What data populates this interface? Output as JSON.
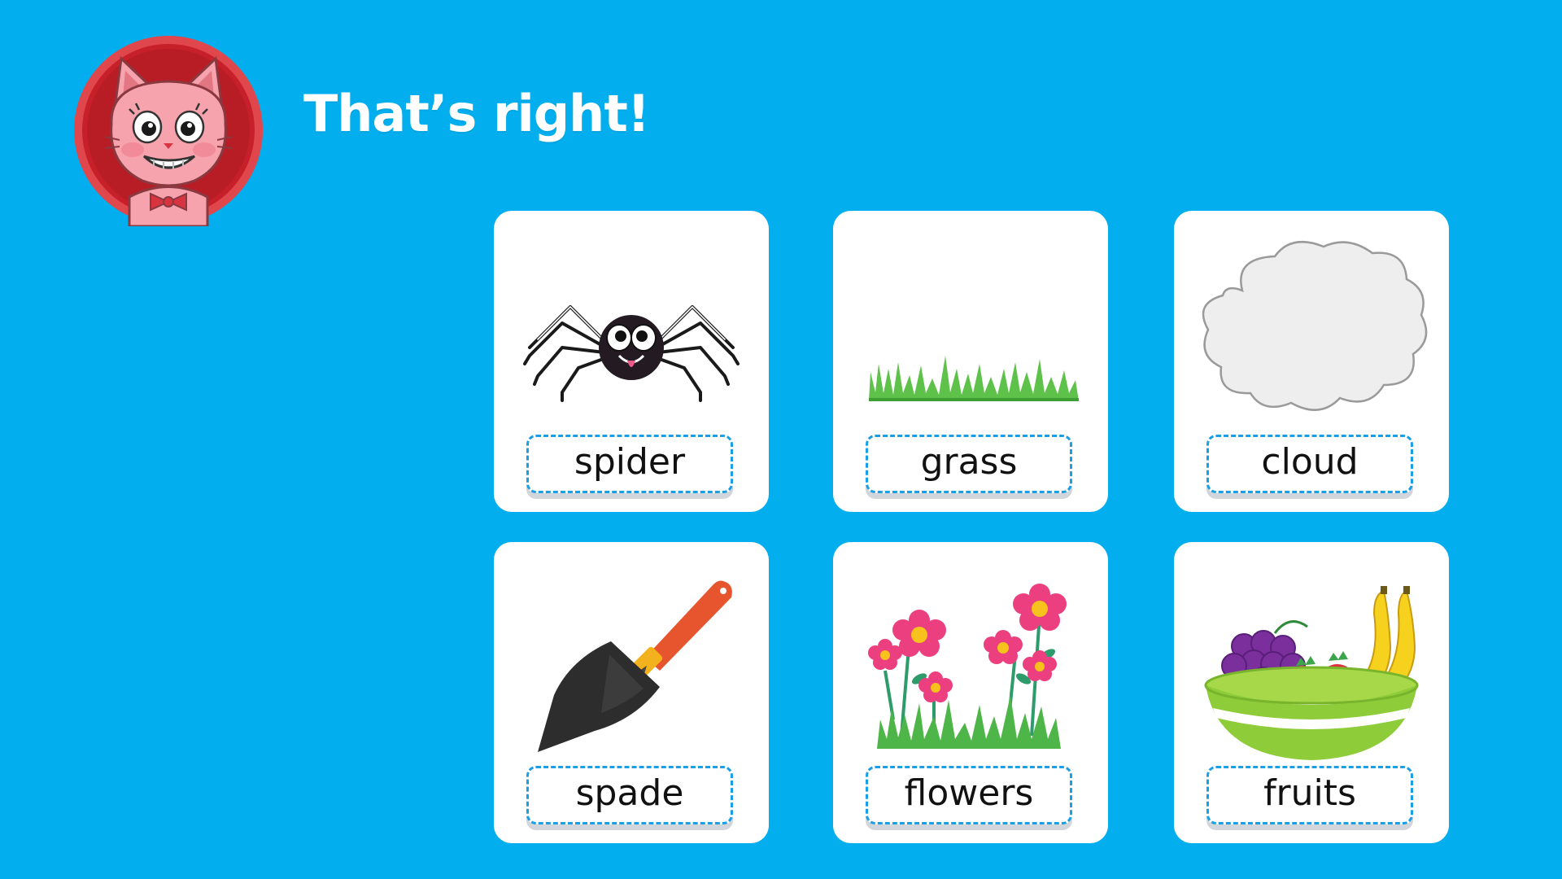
{
  "feedback": {
    "message": "That’s right!"
  },
  "avatar": {
    "icon": "pink-cat-character-icon",
    "ring_color": "#e0474c",
    "face_color": "#f7a3ae"
  },
  "cards": [
    {
      "label": "spider",
      "icon": "spider-icon"
    },
    {
      "label": "grass",
      "icon": "grass-icon"
    },
    {
      "label": "cloud",
      "icon": "cloud-icon"
    },
    {
      "label": "spade",
      "icon": "spade-icon"
    },
    {
      "label": "flowers",
      "icon": "flowers-icon"
    },
    {
      "label": "fruits",
      "icon": "fruit-bowl-icon"
    }
  ],
  "colors": {
    "background": "#03aeee",
    "card": "#ffffff",
    "label_border": "#1a9ee6"
  }
}
